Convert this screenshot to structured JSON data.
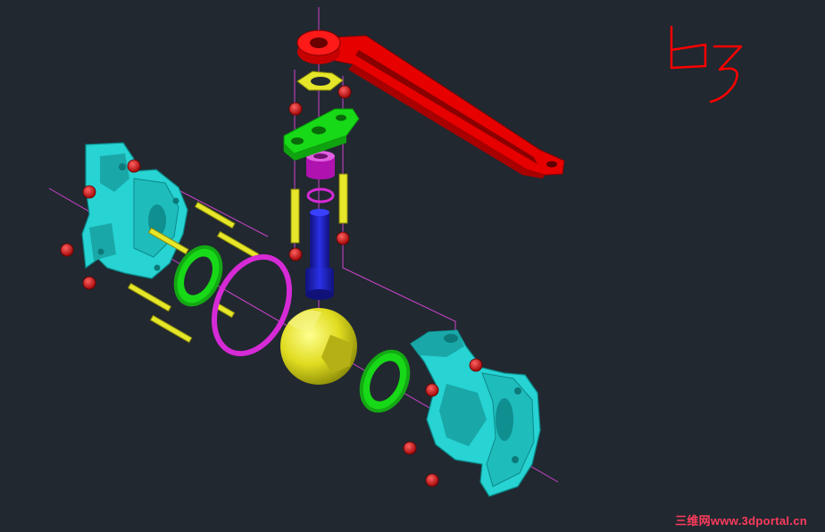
{
  "viewport": {
    "background_color": "#212830",
    "handwritten_annotation": "b3"
  },
  "watermark": {
    "text": "三维网www.3dportal.cn",
    "color": "#ff3b5c"
  },
  "parts": {
    "handle_color": "#e60000",
    "body_color": "#27d3d3",
    "seat_ring_color": "#17d917",
    "gasket_color": "#d62ad6",
    "ball_color": "#e6e62a",
    "stem_color": "#1e22cc",
    "bolt_color": "#e6e62a",
    "nut_color": "#dd0000",
    "centerline_color": "#cc44cc",
    "annotation_color": "#ff0000"
  }
}
